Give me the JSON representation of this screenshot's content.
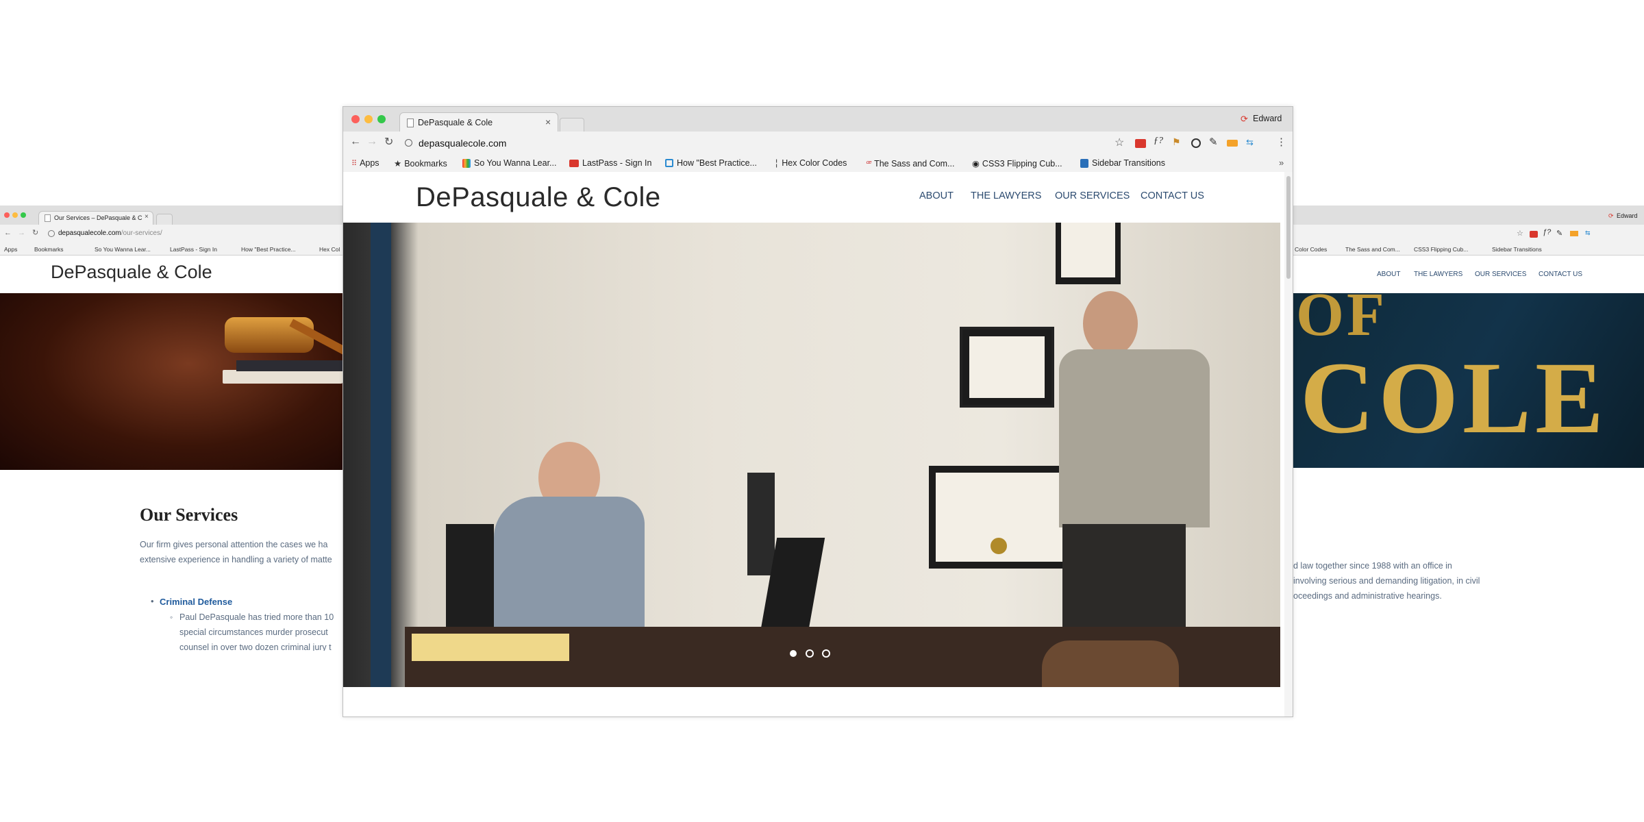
{
  "colors": {
    "nav_text": "#2b4a6f",
    "brand_text": "#2a2a2a",
    "traffic_red": "#fc605b",
    "traffic_yellow": "#fdbc40",
    "traffic_green": "#34c84a",
    "profile_red": "#d9372d"
  },
  "profile": {
    "name": "Edward"
  },
  "bookmarks": [
    {
      "icon": "apps-grid-icon",
      "label": "Apps"
    },
    {
      "icon": "star-icon",
      "label": "Bookmarks"
    },
    {
      "icon": "colorful-book-icon",
      "label": "So You Wanna Lear..."
    },
    {
      "icon": "lastpass-icon",
      "label": "LastPass - Sign In"
    },
    {
      "icon": "circle-q-icon",
      "label": "How \"Best Practice..."
    },
    {
      "icon": "pin-icon",
      "label": "Hex Color Codes"
    },
    {
      "icon": "sass-icon",
      "label": "The Sass and Com..."
    },
    {
      "icon": "swirl-icon",
      "label": "CSS3 Flipping Cub..."
    },
    {
      "icon": "download-box-icon",
      "label": "Sidebar Transitions"
    }
  ],
  "left": {
    "tab_title": "Our Services – DePasquale & C",
    "url_host": "depasqualecole.com",
    "url_path": "/our-services/",
    "bookmarks": [
      "Apps",
      "Bookmarks",
      "So You Wanna Lear...",
      "LastPass - Sign In",
      "How \"Best Practice...",
      "Hex Col"
    ],
    "logo": "DePasquale & Cole",
    "heading": "Our Services",
    "intro_line1": "Our firm gives personal attention the cases we ha",
    "intro_line2": "extensive experience in handling a variety of matte",
    "list_title": "Criminal Defense",
    "sub_line1": "Paul DePasquale has tried more than 10",
    "sub_line2": "special circumstances murder prosecut",
    "sub_line3": "counsel in over two dozen criminal jury t"
  },
  "main": {
    "tab_title": "DePasquale & Cole",
    "url": "depasqualecole.com",
    "logo": "DePasquale & Cole",
    "nav": [
      "ABOUT",
      "THE LAWYERS",
      "OUR SERVICES",
      "CONTACT US"
    ],
    "carousel": {
      "slides": 3,
      "active_index": 0
    },
    "overflow_glyph": "»"
  },
  "right": {
    "bookmarks": [
      "Color Codes",
      "The Sass and Com...",
      "CSS3 Flipping Cub...",
      "Sidebar Transitions"
    ],
    "nav": [
      "ABOUT",
      "THE LAWYERS",
      "OUR SERVICES",
      "CONTACT US"
    ],
    "hero_text": "COLE",
    "hero_text_top": "OF",
    "text_line1": "d law together since 1988 with an office in",
    "text_line2": "involving serious and demanding litigation, in civil",
    "text_line3": "oceedings and administrative hearings."
  }
}
